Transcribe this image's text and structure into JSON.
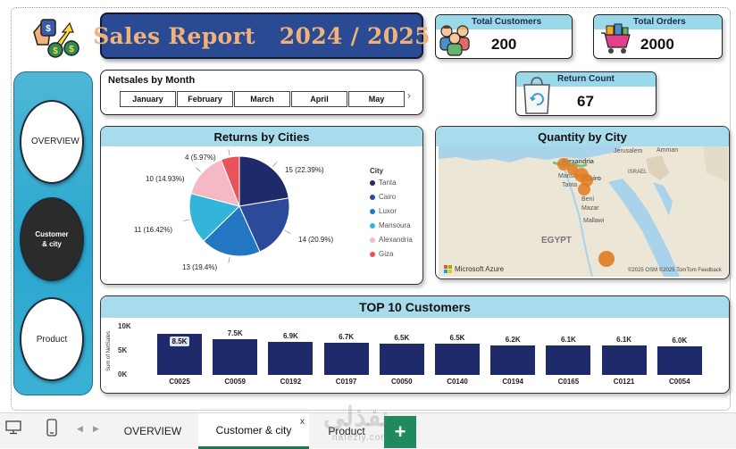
{
  "header": {
    "title": "Sales Report   2024 / 2025"
  },
  "kpis": {
    "total_customers": {
      "label": "Total Customers",
      "value": "200"
    },
    "total_orders": {
      "label": "Total Orders",
      "value": "2000"
    },
    "return_count": {
      "label": "Return Count",
      "value": "67"
    }
  },
  "nav": {
    "items": [
      {
        "label": "OVERVIEW",
        "active": false
      },
      {
        "label": "Customer & city",
        "active": true
      },
      {
        "label": "Product",
        "active": false
      }
    ]
  },
  "slicer": {
    "title": "Netsales by Month",
    "months": [
      "January",
      "February",
      "March",
      "April",
      "May"
    ],
    "next_glyph": "›"
  },
  "returns_chart": {
    "title": "Returns by Cities",
    "legend_title": "City",
    "colors": {
      "Tanta": "#1f2a6b",
      "Cairo": "#2c4a9a",
      "Luxor": "#2376c2",
      "Mansoura": "#33b5d9",
      "Alexandria": "#f7b8c6",
      "Giza": "#e8545a"
    }
  },
  "map": {
    "title": "Quantity by City",
    "labels": [
      "Alexandria",
      "Mansoura",
      "Tanta",
      "Cairo",
      "Beni",
      "Mazar",
      "Mallawi",
      "EGYPT",
      "Jerusalem",
      "Amman",
      "ISRAEL"
    ],
    "brand": "Microsoft Azure",
    "credit": "©2025 OSM  ©2025 TomTom  Feedback"
  },
  "top_customers": {
    "title": "TOP 10 Customers",
    "ylabel": "Sum of NetSales"
  },
  "tabs": {
    "items": [
      "OVERVIEW",
      "Customer & city",
      "Product"
    ],
    "close_glyph": "x",
    "add_glyph": "+"
  },
  "watermark": {
    "brand": "نفذلي",
    "sub": "nafezly.com"
  },
  "chart_data": [
    {
      "type": "pie",
      "title": "Returns by Cities",
      "legend_title": "City",
      "categories": [
        "Tanta",
        "Cairo",
        "Luxor",
        "Mansoura",
        "Alexandria",
        "Giza"
      ],
      "values": [
        15,
        14,
        13,
        11,
        10,
        4
      ],
      "labels": [
        "15 (22.39%)",
        "14 (20.9%)",
        "13 (19.4%)",
        "11 (16.42%)",
        "10 (14.93%)",
        "4 (5.97%)"
      ]
    },
    {
      "type": "bar",
      "title": "TOP 10 Customers",
      "xlabel": "",
      "ylabel": "Sum of NetSales",
      "categories": [
        "C0025",
        "C0059",
        "C0192",
        "C0197",
        "C0050",
        "C0140",
        "C0194",
        "C0165",
        "C0121",
        "C0054"
      ],
      "values": [
        8500,
        7500,
        6900,
        6700,
        6500,
        6500,
        6200,
        6100,
        6100,
        6000
      ],
      "value_labels": [
        "8.5K",
        "7.5K",
        "6.9K",
        "6.7K",
        "6.5K",
        "6.5K",
        "6.2K",
        "6.1K",
        "6.1K",
        "6.0K"
      ],
      "yticks": [
        "10K",
        "5K",
        "0K"
      ],
      "ylim": [
        0,
        10000
      ],
      "grid": false
    }
  ]
}
